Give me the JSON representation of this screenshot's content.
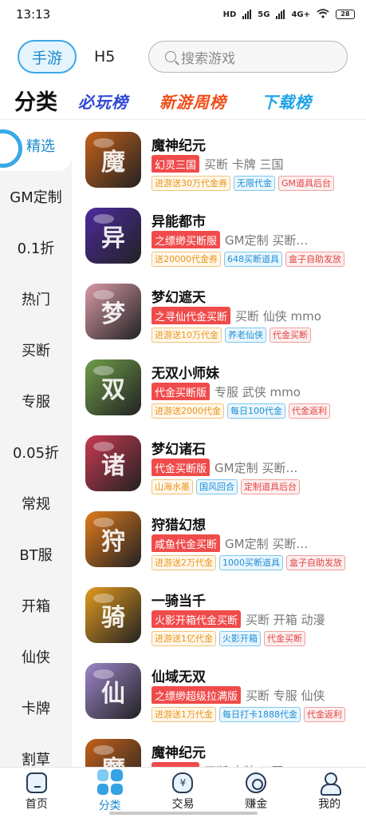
{
  "status_bar": {
    "time": "13:13",
    "network_hd": "HD",
    "network_5g": "5G",
    "network_4g": "4G+",
    "battery": "28"
  },
  "top_tabs": {
    "mobile": "手游",
    "h5": "H5"
  },
  "search": {
    "placeholder": "搜索游戏"
  },
  "category_bar": {
    "title": "分类",
    "rank1": "必玩榜",
    "rank2": "新游周榜",
    "rank3": "下载榜"
  },
  "sidebar": {
    "items": [
      {
        "label": "精选",
        "active": true
      },
      {
        "label": "GM定制"
      },
      {
        "label": "0.1折"
      },
      {
        "label": "热门"
      },
      {
        "label": "买断"
      },
      {
        "label": "专服"
      },
      {
        "label": "0.05折"
      },
      {
        "label": "常规"
      },
      {
        "label": "BT服"
      },
      {
        "label": "开箱"
      },
      {
        "label": "仙侠"
      },
      {
        "label": "卡牌"
      },
      {
        "label": "割草"
      }
    ]
  },
  "games": [
    {
      "name": "魔神纪元",
      "red_tag": "幻灵三国",
      "keywords": "买断 卡牌 三国",
      "tags": [
        {
          "text": "进游送30万代金券",
          "color": "orange"
        },
        {
          "text": "无限代金",
          "color": "blue"
        },
        {
          "text": "GM道具后台",
          "color": "red"
        }
      ],
      "icon": "warrior-icon",
      "icon_glyph": "魔",
      "bg": "#c4611a"
    },
    {
      "name": "异能都市",
      "red_tag": "之缥缈买断服",
      "keywords": "GM定制 买断…",
      "tags": [
        {
          "text": "送20000代金券",
          "color": "orange"
        },
        {
          "text": "648买断道具",
          "color": "blue"
        },
        {
          "text": "盒子自助发放",
          "color": "red"
        }
      ],
      "icon": "cyber-icon",
      "icon_glyph": "异",
      "bg": "#4c2a9e"
    },
    {
      "name": "梦幻遮天",
      "red_tag": "之寻仙代金买断",
      "keywords": "买断 仙侠 mmo",
      "tags": [
        {
          "text": "进游送10万代金",
          "color": "orange"
        },
        {
          "text": "养老仙侠",
          "color": "blue"
        },
        {
          "text": "代金买断",
          "color": "red"
        }
      ],
      "icon": "fairy-icon",
      "icon_glyph": "梦",
      "bg": "#d89aa7"
    },
    {
      "name": "无双小师妹",
      "red_tag": "代金买断版",
      "keywords": "专服 武侠 mmo",
      "tags": [
        {
          "text": "进游送2000代金",
          "color": "orange"
        },
        {
          "text": "每日100代金",
          "color": "blue"
        },
        {
          "text": "代金返利",
          "color": "red"
        }
      ],
      "icon": "girl-icon",
      "icon_glyph": "双",
      "bg": "#6f9d4a"
    },
    {
      "name": "梦幻诸石",
      "red_tag": "代金买断版",
      "keywords": "GM定制 买断…",
      "tags": [
        {
          "text": "山海水墨",
          "color": "orange"
        },
        {
          "text": "国风回合",
          "color": "blue"
        },
        {
          "text": "定制道具后台",
          "color": "red"
        }
      ],
      "icon": "mask-icon",
      "icon_glyph": "诸",
      "bg": "#c93a52"
    },
    {
      "name": "狩猎幻想",
      "red_tag": "咸鱼代金买断",
      "keywords": "GM定制 买断…",
      "tags": [
        {
          "text": "进游送2万代金",
          "color": "orange"
        },
        {
          "text": "1000买断道具",
          "color": "blue"
        },
        {
          "text": "盒子自助发放",
          "color": "red"
        }
      ],
      "icon": "monster-icon",
      "icon_glyph": "狩",
      "bg": "#e07b1c"
    },
    {
      "name": "一骑当千",
      "red_tag": "火影开箱代金买断",
      "keywords": "买断 开箱 动漫",
      "tags": [
        {
          "text": "进游送1亿代金",
          "color": "orange"
        },
        {
          "text": "火影开箱",
          "color": "blue"
        },
        {
          "text": "代金买断",
          "color": "red"
        }
      ],
      "icon": "ninja-icon",
      "icon_glyph": "骑",
      "bg": "#e39a1e"
    },
    {
      "name": "仙域无双",
      "red_tag": "之缥缈超级拉满版",
      "keywords": "买断 专服 仙侠",
      "tags": [
        {
          "text": "进游送1万代金",
          "color": "orange"
        },
        {
          "text": "每日打卡1888代金",
          "color": "blue"
        },
        {
          "text": "代金返利",
          "color": "red"
        }
      ],
      "icon": "immortal-icon",
      "icon_glyph": "仙",
      "bg": "#9d86c9"
    },
    {
      "name": "魔神纪元",
      "red_tag": "幻灵三国",
      "keywords": "买断 卡牌 三国",
      "tags": [],
      "icon": "warrior-icon",
      "icon_glyph": "魔",
      "bg": "#c4611a"
    }
  ],
  "bottom_nav": {
    "items": [
      {
        "label": "首页"
      },
      {
        "label": "分类",
        "active": true
      },
      {
        "label": "交易",
        "icon_text": "¥"
      },
      {
        "label": "赚金"
      },
      {
        "label": "我的"
      }
    ]
  },
  "colors": {
    "accent": "#3aa8e6",
    "tag_red": "#f04b4b",
    "rank_blue": "#2f47d8",
    "rank_orange": "#f04d18",
    "rank_cyan": "#1ea3e8"
  }
}
